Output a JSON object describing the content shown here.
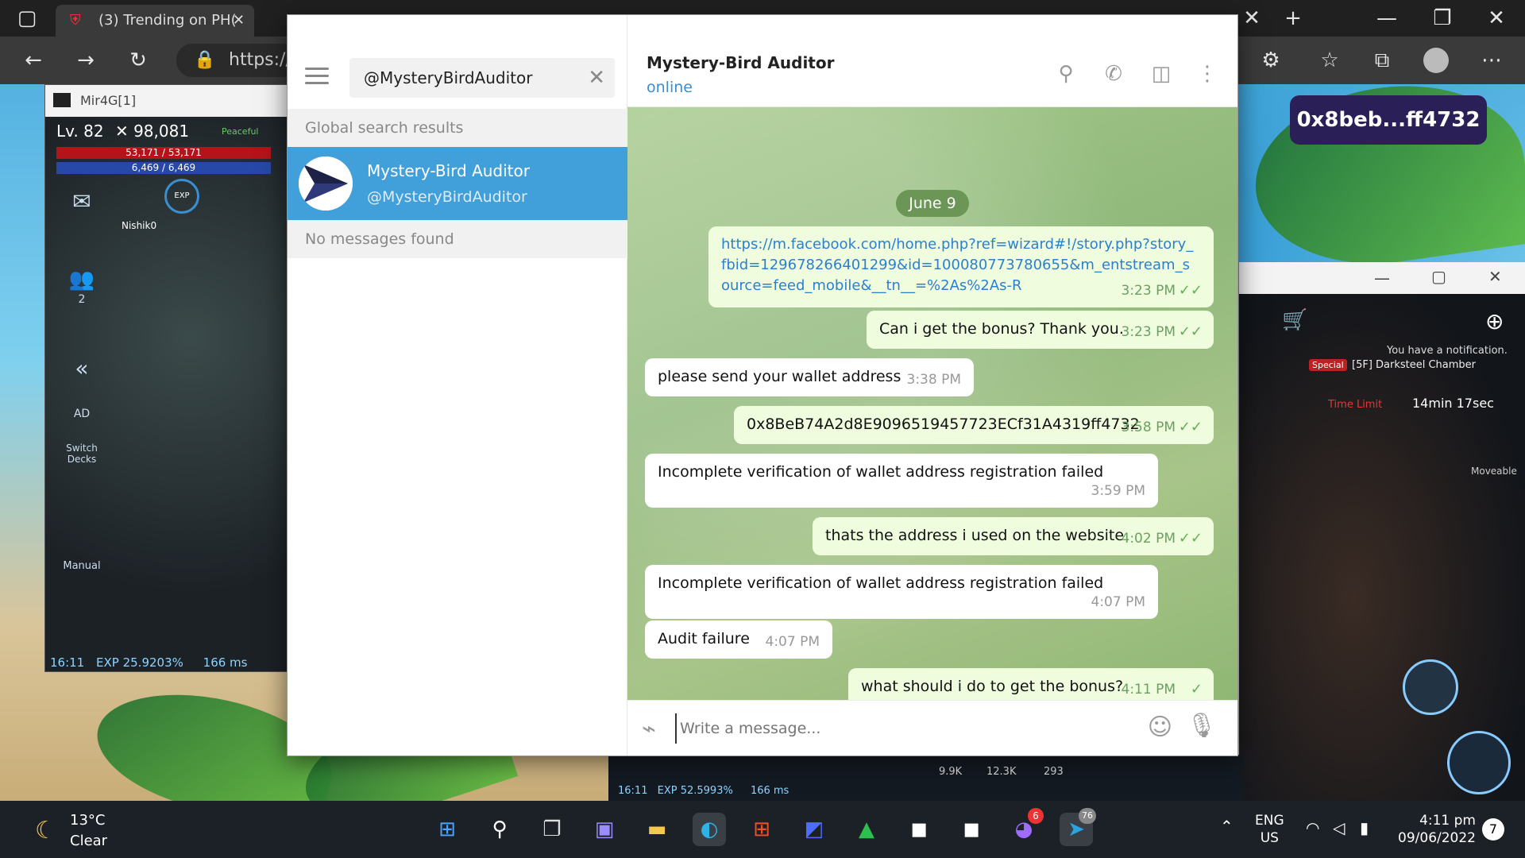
{
  "browser": {
    "active_tab_title": "(3) Trending on PH(",
    "address_partial": "https://\\",
    "toolbar_icons": [
      "back-icon",
      "forward-icon",
      "refresh-icon",
      "lock-icon",
      "extensions-icon",
      "favorites-icon",
      "collections-icon",
      "profile-icon",
      "more-icon"
    ]
  },
  "game_left": {
    "title": "Mir4G[1]",
    "level": "Lv. 82",
    "power": "98,081",
    "peaceful": "Peaceful",
    "hp": "53,171 / 53,171",
    "mp": "6,469 / 6,469",
    "player_name": "Nishik0",
    "side_labels": [
      "AD",
      "Switch Decks",
      "Manual"
    ],
    "party_count": "2",
    "status_time": "16:11",
    "status_exp": "EXP 25.9203%",
    "status_ping": "166 ms"
  },
  "game_right": {
    "notification": "You have a notification.",
    "special": "Special",
    "location": "[5F] Darksteel Chamber",
    "time_limit_label": "Time Limit",
    "time_limit_value": "14min 17sec",
    "moveable": "Moveable"
  },
  "game_bottom": {
    "status_time": "16:11",
    "status_exp": "EXP 52.5993%",
    "status_ping": "166 ms",
    "counts": [
      "9.9K",
      "12.3K",
      "293"
    ]
  },
  "wallet_pill": "0x8beb...ff4732",
  "telegram": {
    "search_value": "@MysteryBirdAuditor",
    "global_search_label": "Global search results",
    "result_name": "Mystery-Bird Auditor",
    "result_username": "@MysteryBirdAuditor",
    "no_messages": "No messages found",
    "chat_name": "Mystery-Bird Auditor",
    "chat_status": "online",
    "date_badge": "June 9",
    "composer_placeholder": "Write a message...",
    "messages": [
      {
        "dir": "out",
        "text": "https://m.facebook.com/home.php?ref=wizard#!/story.php?story_fbid=129678266401299&id=100080773780655&m_entstream_source=feed_mobile&__tn__=%2As%2As-R",
        "time": "3:23 PM",
        "link": true
      },
      {
        "dir": "out",
        "text": "Can i get the bonus? Thank you.",
        "time": "3:23 PM"
      },
      {
        "dir": "in",
        "text": "please send your wallet address",
        "time": "3:38 PM"
      },
      {
        "dir": "out",
        "text": "0x8BeB74A2d8E9096519457723ECf31A4319ff4732",
        "time": "3:58 PM"
      },
      {
        "dir": "in",
        "text": "Incomplete verification of wallet address registration failed",
        "time": "3:59 PM"
      },
      {
        "dir": "out",
        "text": "thats the address i used on the website",
        "time": "4:02 PM"
      },
      {
        "dir": "in",
        "text": "Incomplete verification of wallet address registration failed",
        "time": "4:07 PM"
      },
      {
        "dir": "in",
        "text": "Audit failure",
        "time": "4:07 PM"
      },
      {
        "dir": "out",
        "text": "what should i do to get the bonus?",
        "time": "4:11 PM"
      }
    ]
  },
  "taskbar": {
    "weather_temp": "13°C",
    "weather_desc": "Clear",
    "lang_line1": "ENG",
    "lang_line2": "US",
    "time": "4:11 pm",
    "date": "09/06/2022",
    "notification_count": "7",
    "messenger_badge": "6",
    "telegram_badge": "76"
  }
}
